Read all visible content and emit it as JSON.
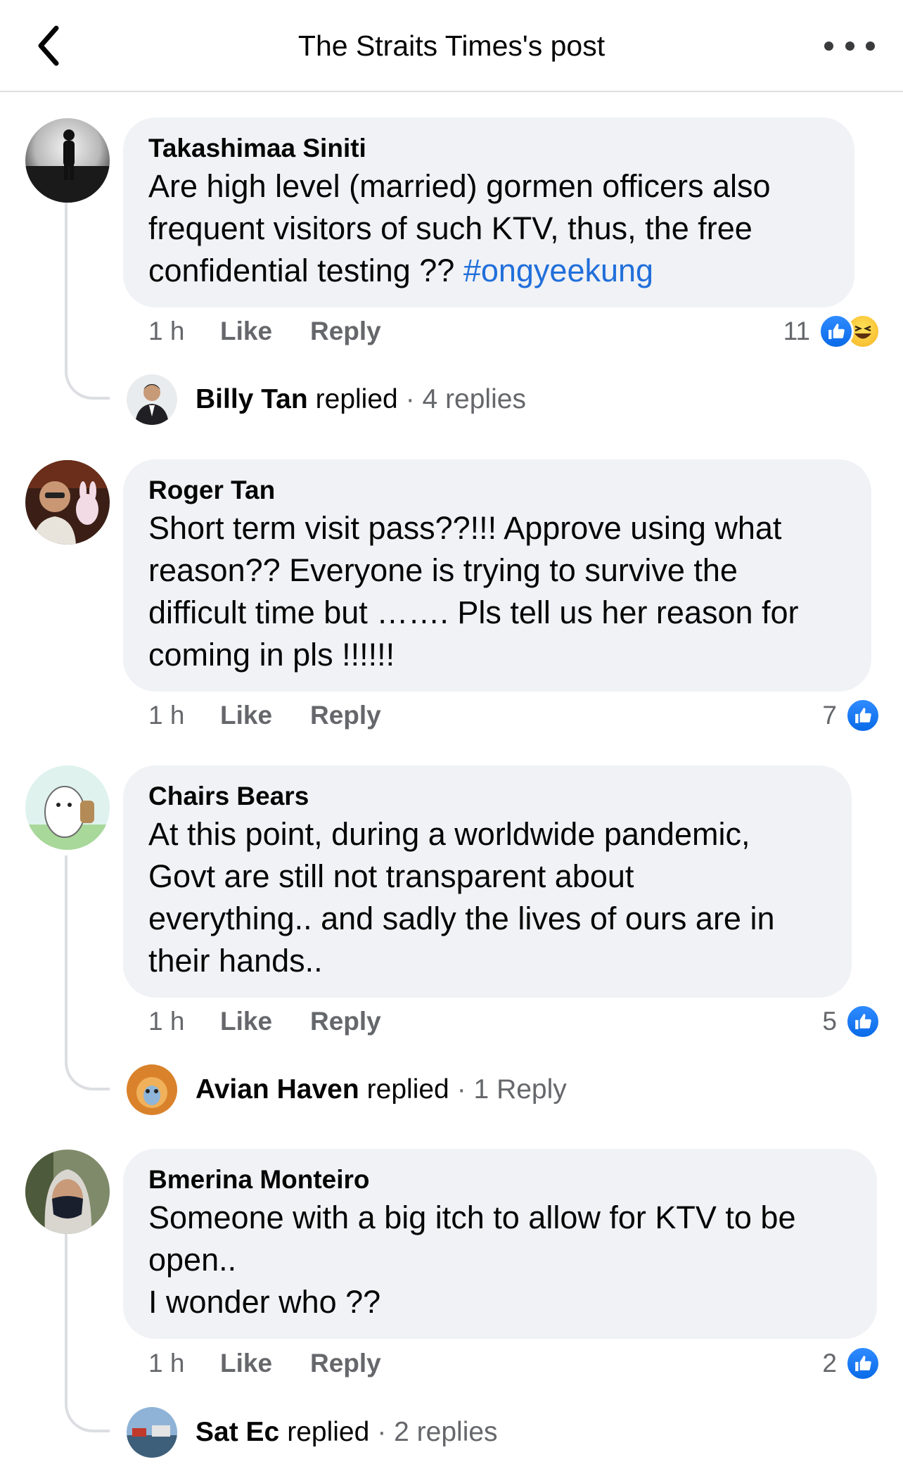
{
  "header": {
    "title": "The Straits Times's post",
    "back_icon": "chevron-left-icon",
    "more_icon": "more-horizontal-icon"
  },
  "actions": {
    "like_label": "Like",
    "reply_label": "Reply"
  },
  "colors": {
    "link": "#216fdb",
    "bubble": "#f0f2f5",
    "muted": "#65676b",
    "like_blue": "#1877f2"
  },
  "comments": [
    {
      "author": "Takashimaa Siniti",
      "lines": [
        "Are high level (married) gormen officers also",
        "frequent visitors of such KTV, thus, the free",
        "confidential testing ?? "
      ],
      "hashtag": "#ongyeekung",
      "time": "1 h",
      "reaction_count": "11",
      "reactions": [
        "like-icon",
        "haha-icon"
      ],
      "reply": {
        "name": "Billy Tan",
        "verb": "replied",
        "count": "· 4 replies"
      }
    },
    {
      "author": "Roger Tan",
      "lines": [
        "Short term visit pass??!!! Approve using what",
        "reason?? Everyone is trying to survive the",
        "difficult time but ……. Pls tell us her reason for",
        "coming in pls !!!!!!"
      ],
      "time": "1 h",
      "reaction_count": "7",
      "reactions": [
        "like-icon"
      ]
    },
    {
      "author": "Chairs Bears",
      "lines": [
        "At this point, during a worldwide pandemic,",
        "Govt are still not transparent about",
        "everything.. and sadly the lives of ours are in",
        "their hands.."
      ],
      "time": "1 h",
      "reaction_count": "5",
      "reactions": [
        "like-icon"
      ],
      "reply": {
        "name": "Avian Haven",
        "verb": "replied",
        "count": "· 1 Reply"
      }
    },
    {
      "author": "Bmerina Monteiro",
      "lines": [
        "Someone with a big itch to allow for KTV to be",
        "open..",
        "I wonder who ??"
      ],
      "time": "1 h",
      "reaction_count": "2",
      "reactions": [
        "like-icon"
      ],
      "reply": {
        "name": "Sat Ec",
        "verb": "replied",
        "count": "· 2 replies"
      }
    }
  ]
}
